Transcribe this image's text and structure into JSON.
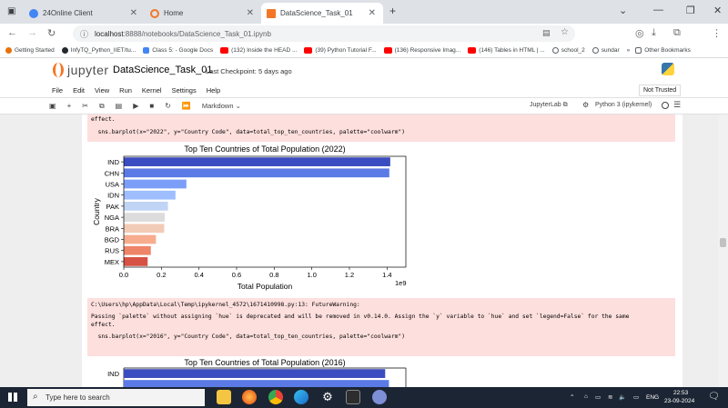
{
  "browser": {
    "tabs": [
      {
        "title": "24Online Client",
        "icon_color": "#4285f4"
      },
      {
        "title": "Home",
        "icon_color": "#f37726"
      },
      {
        "title": "DataScience_Task_01",
        "icon_color": "#f37726"
      }
    ],
    "url_host": "localhost",
    "url_path": ":8888/notebooks/DataScience_Task_01.ipynb",
    "bookmarks": [
      {
        "label": "Getting Started",
        "color": "#e8710a"
      },
      {
        "label": "InfyTQ_Python_IIET/tu...",
        "color": "#24292e"
      },
      {
        "label": "Class 5: - Google Docs",
        "color": "#4285f4"
      },
      {
        "label": "(132) Inside the HEAD ...",
        "color": "#ff0000"
      },
      {
        "label": "(39) Python Tutorial F...",
        "color": "#ff0000"
      },
      {
        "label": "(136) Responsive Imag...",
        "color": "#ff0000"
      },
      {
        "label": "(146) Tables in HTML | ...",
        "color": "#ff0000"
      },
      {
        "label": "school_2",
        "color": "#5f6368"
      },
      {
        "label": "sundar",
        "color": "#5f6368"
      }
    ],
    "other_bookmarks": "Other Bookmarks"
  },
  "jupyter": {
    "logo_text": "jupyter",
    "notebook_title": "DataScience_Task_01",
    "checkpoint": "Last Checkpoint: 5 days ago",
    "not_trusted": "Not Trusted",
    "menu": [
      "File",
      "Edit",
      "View",
      "Run",
      "Kernel",
      "Settings",
      "Help"
    ],
    "cell_type": "Markdown",
    "jupyterlab_label": "JupyterLab",
    "kernel": "Python 3 (ipykernel)"
  },
  "notebook": {
    "warn1": {
      "line1": "effect.",
      "code": "  sns.barplot(x=\"2022\", y=\"Country Code\", data=total_top_ten_countries, palette=\"coolwarm\")"
    },
    "warn2": {
      "path": "C:\\Users\\hp\\AppData\\Local\\Temp\\ipykernel_4572\\1671410998.py:13: FutureWarning:",
      "msg1": "Passing `palette` without assigning `hue` is deprecated and will be removed in v0.14.0. Assign the `y` variable to `hue` and set `legend=False` for the same",
      "msg2": "effect.",
      "code": "  sns.barplot(x=\"2016\", y=\"Country Code\", data=total_top_ten_countries, palette=\"coolwarm\")"
    }
  },
  "chart_data": [
    {
      "type": "bar",
      "orientation": "horizontal",
      "title": "Top Ten Countries of Total Population (2022)",
      "xlabel": "Total Population",
      "ylabel": "Country",
      "x_scale_label": "1e9",
      "xlim": [
        0,
        1.5
      ],
      "xticks": [
        "0.0",
        "0.2",
        "0.4",
        "0.6",
        "0.8",
        "1.0",
        "1.2",
        "1.4"
      ],
      "categories": [
        "IND",
        "CHN",
        "USA",
        "IDN",
        "PAK",
        "NGA",
        "BRA",
        "BGD",
        "RUS",
        "MEX"
      ],
      "values": [
        1.417,
        1.412,
        0.333,
        0.275,
        0.235,
        0.218,
        0.215,
        0.171,
        0.144,
        0.127
      ],
      "colors": [
        "#3b4cc0",
        "#5b7ae5",
        "#7b9ff9",
        "#9ebeff",
        "#c0d4f5",
        "#dddcdc",
        "#f2cbb7",
        "#f7ac8e",
        "#ee8468",
        "#d65244"
      ]
    },
    {
      "type": "bar",
      "orientation": "horizontal",
      "title": "Top Ten Countries of Total Population (2016)",
      "categories": [
        "IND"
      ],
      "values": [
        1.39
      ],
      "colors": [
        "#3b4cc0"
      ]
    }
  ],
  "taskbar": {
    "search_placeholder": "Type here to search",
    "lang": "ENG",
    "time": "22:53",
    "date": "23-09-2024"
  }
}
